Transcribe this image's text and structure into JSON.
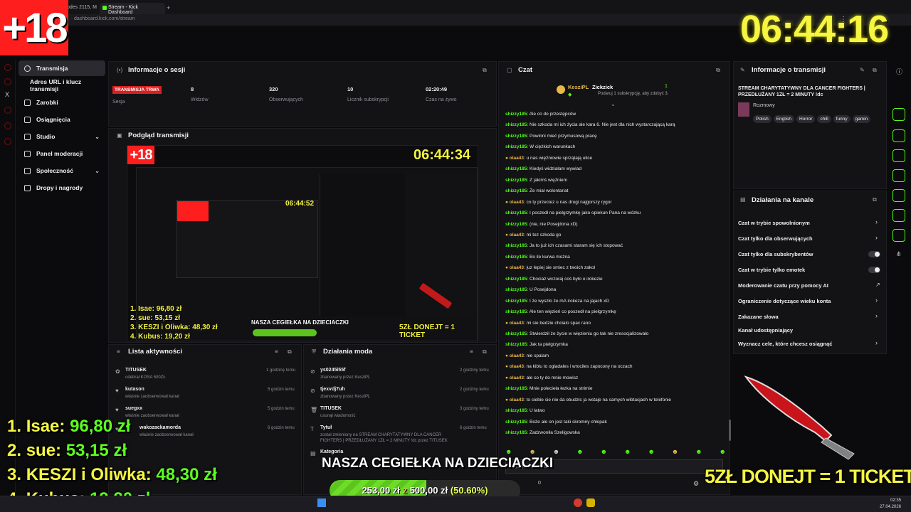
{
  "browser": {
    "tabs": [
      {
        "label": "odes 2115, M"
      },
      {
        "label": "Stream - Kick Dashboard"
      }
    ],
    "url": "dashboard.kick.com/stream"
  },
  "sidebar": {
    "items": [
      {
        "label": "Transmisja",
        "icon": "broadcast-icon",
        "selected": true
      },
      {
        "label": "Adres URL i klucz transmisji",
        "icon": "",
        "selected": false
      },
      {
        "label": "Zarobki",
        "icon": "wallet-icon",
        "selected": false
      },
      {
        "label": "Osiągnięcia",
        "icon": "trophy-icon",
        "selected": false
      },
      {
        "label": "Studio",
        "icon": "studio-icon",
        "selected": false,
        "chevron": true
      },
      {
        "label": "Panel moderacji",
        "icon": "shield-icon",
        "selected": false
      },
      {
        "label": "Społeczność",
        "icon": "people-icon",
        "selected": false,
        "chevron": true
      },
      {
        "label": "Dropy i nagrody",
        "icon": "gift-icon",
        "selected": false
      }
    ]
  },
  "session": {
    "title": "Informacje o sesji",
    "live_badge": "TRANSMISJA TRWA",
    "stats": [
      {
        "label": "Sesja",
        "value": ""
      },
      {
        "label": "Widzów",
        "value": "8"
      },
      {
        "label": "Obserwujących",
        "value": "320"
      },
      {
        "label": "Licznik subskrypcji",
        "value": "10"
      },
      {
        "label": "Czas na żywo",
        "value": "02:20:49"
      }
    ]
  },
  "preview": {
    "title": "Podgląd transmisji",
    "overlay_clock": "06:44:34",
    "overlay_clock_inner": "06:44:52",
    "overlay_plus18": "+18",
    "leaderboard": [
      "1. Isae: 96,80 zł",
      "2. sue: 53,15 zł",
      "3. KESZI i Oliwka: 48,30 zł",
      "4. Kubus: 19,20 zł"
    ],
    "charity": "NASZA CEGIEŁKA NA DZIECIACZKI",
    "ticket": "5ZŁ DONEJT = 1 TICKET"
  },
  "activity": {
    "title": "Lista aktywności",
    "rows": [
      {
        "name": "TITUSEK",
        "sub": "odebrał KOSA 500ZŁ",
        "time": "1 godzinę temu",
        "icon": "gift-icon"
      },
      {
        "name": "kutason",
        "sub": "właśnie zaobserwował kanał",
        "time": "5 godzin temu",
        "icon": "heart-icon"
      },
      {
        "name": "suegxx",
        "sub": "właśnie zaobserwował kanał",
        "time": "5 godzin temu",
        "icon": "heart-icon"
      },
      {
        "name": "wakozackamorda",
        "sub": "właśnie zaobserwował kanał",
        "time": "6 godzin temu",
        "icon": "heart-icon"
      }
    ]
  },
  "modactions": {
    "title": "Działania moda",
    "rows": [
      {
        "name": "ys0245i55f",
        "sub": "zbanowany przez KesziPL",
        "time": "2 godziny temu",
        "icon": "ban-icon"
      },
      {
        "name": "tjexvdj7uh",
        "sub": "zbanowany przez KesziPL",
        "time": "2 godziny temu",
        "icon": "ban-icon"
      },
      {
        "name": "TITUSEK",
        "sub": "usunął wiadomość",
        "time": "3 godziny temu",
        "icon": "trash-icon"
      },
      {
        "name": "Tytuł",
        "sub": "został zmieniony na STREAM CHARYTATYWNY DLA CANCER FIGHTERS | PRZEDŁUŻANY 1ZŁ = 2 MINUTY !dc przez TITUSEK",
        "time": "6 godzin temu",
        "icon": "tag-icon"
      },
      {
        "name": "Kategoria",
        "sub": "",
        "time": "",
        "icon": "category-icon"
      }
    ]
  },
  "chat": {
    "title": "Czat",
    "pinned": {
      "user1": "KesziPL",
      "user2": "Zickzick",
      "count": "1",
      "text": "Podaruj 1 subskrypcję, aby zdobyć 3."
    },
    "messages": [
      {
        "user": "shizzy185",
        "text": "Ale co do przestępców",
        "gold": false
      },
      {
        "user": "shizzy185",
        "text": "Nie szkoda mi ich życia ale kara 6. Nie jest dla nich wystarczającą karą",
        "gold": false
      },
      {
        "user": "shizzy185",
        "text": "Powinni mieć przymusową pracę",
        "gold": false
      },
      {
        "user": "shizzy185",
        "text": "W ciężkich warunkach",
        "gold": false
      },
      {
        "user": "olaa43",
        "text": "u nas więźniowie sprzątają ulice",
        "gold": true
      },
      {
        "user": "shizzy185",
        "text": "Kiedyś widziałam wywiad",
        "gold": false
      },
      {
        "user": "shizzy185",
        "text": "Z jakimś więźniem",
        "gold": false
      },
      {
        "user": "shizzy185",
        "text": "Że miał wolontariat",
        "gold": false
      },
      {
        "user": "olaa43",
        "text": "co ty przeciez u nas drugi najgorszy rygor",
        "gold": true
      },
      {
        "user": "shizzy185",
        "text": "I poszedł na pielgrzymkę jako opiekun Pana na wózku",
        "gold": false
      },
      {
        "user": "shizzy185",
        "text": "(nie, nie Posejdona xD)",
        "gold": false
      },
      {
        "user": "olaa43",
        "text": "mi tez szkoda go",
        "gold": true
      },
      {
        "user": "shizzy185",
        "text": "Ja to już ich czasami staram się ich stopować",
        "gold": false
      },
      {
        "user": "shizzy185",
        "text": "Bo ile kurwa można",
        "gold": false
      },
      {
        "user": "olaa43",
        "text": "juz lepiej sie smiec z twoich zakol",
        "gold": true
      },
      {
        "user": "shizzy185",
        "text": "Chociaż wczoraj coś było o irokezie",
        "gold": false
      },
      {
        "user": "shizzy185",
        "text": "U Posejdona",
        "gold": false
      },
      {
        "user": "shizzy185",
        "text": "I że wyszło że mA irokeza na jajach xD",
        "gold": false
      },
      {
        "user": "shizzy185",
        "text": "Ale ten więzień co poszedł na pielgrzymkę",
        "gold": false
      },
      {
        "user": "olaa43",
        "text": "mi sie bedzie chcialo spac rano",
        "gold": true
      },
      {
        "user": "shizzy185",
        "text": "Stwierdził że życie w więzieniu go tak nie zresocjalizowało",
        "gold": false
      },
      {
        "user": "shizzy185",
        "text": "Jak ta pielgrzymka",
        "gold": false
      },
      {
        "user": "olaa43",
        "text": "nie spalam",
        "gold": true
      },
      {
        "user": "olaa43",
        "text": "na kiblu to ogladales i wrociles zapocony na oczach",
        "gold": true
      },
      {
        "user": "olaa43",
        "text": "ale co ty do mnie mowisz",
        "gold": true
      },
      {
        "user": "shizzy185",
        "text": "Mnie polecieła łezka na strimie",
        "gold": false
      },
      {
        "user": "olaa43",
        "text": "to ciebie sie nie da obudzic ja wstaje na samych wibtacjach w telefonie",
        "gold": true
      },
      {
        "user": "shizzy185",
        "text": "U łatwo",
        "gold": false
      },
      {
        "user": "shizzy185",
        "text": "Boże ale on jest taki skromny chłopak",
        "gold": false
      },
      {
        "user": "shizzy185",
        "text": "Zadzwoniła Szeligowska",
        "gold": false
      }
    ],
    "input_placeholder": "Wyślij wiadomość",
    "counter": "0"
  },
  "stream_info": {
    "title": "Informacje o transmisji",
    "stream_title": "STREAM CHARYTATYWNY DLA CANCER FIGHTERS | PRZEDŁUŻANY 1ZŁ = 2 MINUTY !dc",
    "category": "Rozmowy",
    "tags": [
      "Polish",
      "English",
      "Horror",
      "chill",
      "funny",
      "gamin"
    ]
  },
  "channel_actions": {
    "title": "Działania na kanale",
    "rows": [
      {
        "label": "Czat w trybie spowolnionym",
        "control": "arrow"
      },
      {
        "label": "Czat tylko dla obserwujących",
        "control": "arrow"
      },
      {
        "label": "Czat tylko dla subskrybentów",
        "control": "toggle"
      },
      {
        "label": "Czat w trybie tylko emotek",
        "control": "toggle"
      },
      {
        "label": "Moderowanie czatu przy pomocy AI",
        "control": "external"
      },
      {
        "label": "Ograniczenie dotyczące wieku konta",
        "control": "arrow"
      },
      {
        "label": "Zakazane słowa",
        "control": "arrow"
      },
      {
        "label": "Kanał udostępniający",
        "control": "none"
      },
      {
        "label": "Wyznacz cele, które chcesz osiągnąć",
        "control": "arrow"
      }
    ]
  },
  "overlay": {
    "plus18": "+18",
    "clock": "06:44:16",
    "leaderboard": [
      {
        "rank": "1.",
        "name": "Isae:",
        "amount": "96,80 zł"
      },
      {
        "rank": "2.",
        "name": "sue:",
        "amount": "53,15 zł"
      },
      {
        "rank": "3.",
        "name": "KESZI i Oliwka:",
        "amount": "48,30 zł"
      },
      {
        "rank": "4.",
        "name": "Kubus:",
        "amount": "19,20 zł"
      }
    ],
    "charity": "NASZA CEGIEŁKA NA DZIECIACZKI",
    "donation": {
      "current": "253,00 zł",
      "sep": "z",
      "goal": "500,00 zł",
      "percent": "(50.60%)",
      "progress": 0.506
    },
    "ticket": "5ZŁ DONEJT = 1 TICKET"
  },
  "taskbar": {
    "time": "02:35",
    "date": "27.04.2026"
  },
  "colors": {
    "accent": "#53fc18",
    "live": "#d92020",
    "overlay_yellow": "#f5f542",
    "overlay_green": "#5dff1e"
  }
}
